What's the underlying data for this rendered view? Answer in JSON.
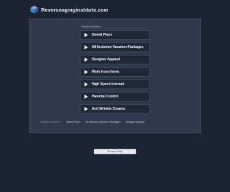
{
  "header": {
    "site_name": "Reverseaginginstitute.com",
    "logo_icon": "cube-logo-icon"
  },
  "related": {
    "title": "Related Searches:",
    "items": [
      {
        "label": "Dental Plans"
      },
      {
        "label": "All Inclusive Vacation Packages"
      },
      {
        "label": "Designer Apparel"
      },
      {
        "label": "Work from Home"
      },
      {
        "label": "High Speed Internet"
      },
      {
        "label": "Parental Control"
      },
      {
        "label": "Anti Wrinkle Creams"
      }
    ]
  },
  "bottom": {
    "heading": "Related Searches:",
    "links": [
      "Dental Plans",
      "All Inclusive Vacation Packages",
      "Designer Apparel"
    ]
  },
  "footer": {
    "privacy_label": "Privacy Policy"
  },
  "colors": {
    "background": "#1c2433",
    "panel": "#303a4c",
    "item": "#1f2837",
    "arrow": "#ffffff",
    "logo": "#4f7fc4"
  }
}
